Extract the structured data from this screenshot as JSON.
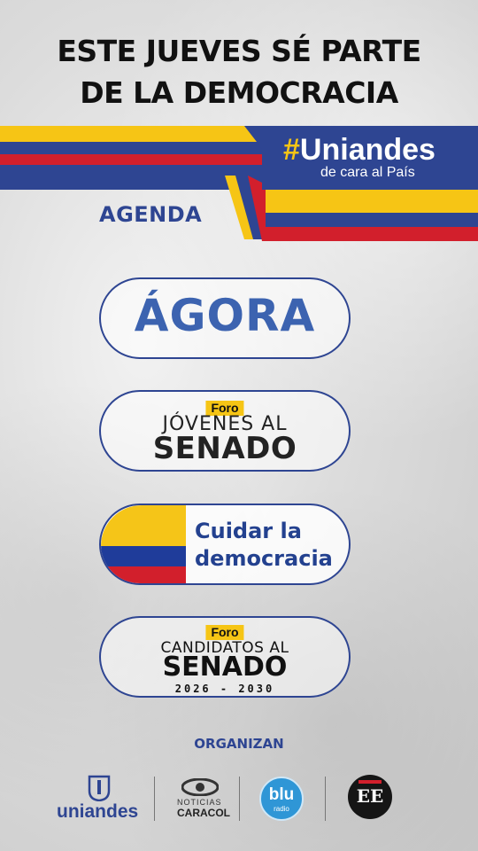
{
  "headline": {
    "line1": "ESTE JUEVES SÉ PARTE",
    "line2": "DE LA DEMOCRACIA"
  },
  "campaign": {
    "hashtag": "#",
    "title": "Uniandes",
    "subtitle": "de cara al País"
  },
  "agenda_label": "AGENDA",
  "events": [
    {
      "title": "ÁGORA"
    },
    {
      "tag": "Foro",
      "line1": "JÓVENES AL",
      "line2": "SENADO"
    },
    {
      "line1": "Cuidar la",
      "line2": "democracia"
    },
    {
      "tag": "Foro",
      "line1": "CANDIDATOS AL",
      "line2": "SENADO",
      "line3": "2026 - 2030"
    }
  ],
  "organizers": {
    "label": "ORGANIZAN",
    "logos": [
      {
        "name": "uniandes",
        "text": "uniandes"
      },
      {
        "name": "noticias-caracol",
        "line1": "NOTICIAS",
        "line2": "CARACOL"
      },
      {
        "name": "blu-radio",
        "text": "blu",
        "sub": "radio"
      },
      {
        "name": "el-espectador",
        "text": "EE"
      }
    ]
  },
  "colors": {
    "flag_yellow": "#f6c515",
    "flag_blue": "#2e4592",
    "flag_red": "#d21f2c",
    "accent_blue": "#2e4592"
  }
}
